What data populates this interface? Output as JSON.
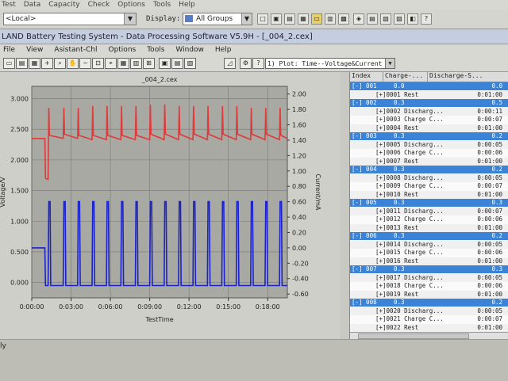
{
  "top_menu": [
    "Test",
    "Data",
    "Capacity",
    "Check",
    "Options",
    "Tools",
    "Help"
  ],
  "toolbar_top": {
    "location": "<Local>",
    "display_label": "Display:",
    "display_value": "All Groups"
  },
  "window": {
    "title": "LAND Battery Testing System - Data Processing Software V5.9H - [_004_2.cex]"
  },
  "menu": [
    "File",
    "View",
    "Asistant-Chl",
    "Options",
    "Tools",
    "Window",
    "Help"
  ],
  "plot_select": "1) Plot: Time--Voltage&Current",
  "status_text": "ly",
  "colors": {
    "voltage": "#e03a3a",
    "current": "#1a22c8",
    "plot_bg": "#a9a9a3",
    "group_row": "#3b83d6"
  },
  "chart_data": {
    "type": "line",
    "title": "_004_2.cex",
    "xlabel": "TestTime",
    "ylabel_left": "Voltage/V",
    "ylabel_right": "Current/mA",
    "x_ticks": [
      "0:00:00",
      "0:03:00",
      "0:06:00",
      "0:09:00",
      "0:12:00",
      "0:15:00",
      "0:18:00"
    ],
    "x_tick_minutes": [
      0,
      3,
      6,
      9,
      12,
      15,
      18
    ],
    "xlim_minutes": [
      0,
      19.5
    ],
    "y_left_ticks": [
      "3.000",
      "2.500",
      "2.000",
      "1.500",
      "1.000",
      "0.500",
      "0.000"
    ],
    "y_left_tick_values": [
      3.0,
      2.5,
      2.0,
      1.5,
      1.0,
      0.5,
      0.0
    ],
    "ylim_left": [
      -0.25,
      3.2
    ],
    "y_right_ticks": [
      "2.00",
      "1.80",
      "1.60",
      "1.40",
      "1.20",
      "1.00",
      "0.80",
      "0.60",
      "0.40",
      "0.20",
      "0.00",
      "-0.20",
      "-0.40",
      "-0.60"
    ],
    "y_right_tick_values": [
      2.0,
      1.8,
      1.6,
      1.4,
      1.2,
      1.0,
      0.8,
      0.6,
      0.4,
      0.2,
      0.0,
      -0.2,
      -0.4,
      -0.6
    ],
    "ylim_right": [
      -0.65,
      2.1
    ],
    "grid": true,
    "series": [
      {
        "name": "Voltage",
        "axis": "left",
        "color": "#e03a3a",
        "points": [
          [
            0,
            2.35
          ],
          [
            1.0,
            2.35
          ],
          [
            1.05,
            1.7
          ],
          [
            1.25,
            1.68
          ],
          [
            1.3,
            2.85
          ],
          [
            1.35,
            2.4
          ],
          [
            2.4,
            2.35
          ],
          [
            2.45,
            2.85
          ],
          [
            2.5,
            2.42
          ],
          [
            3.5,
            2.35
          ],
          [
            3.55,
            2.85
          ],
          [
            3.6,
            2.4
          ],
          [
            4.6,
            2.33
          ],
          [
            4.65,
            2.88
          ],
          [
            4.7,
            2.4
          ],
          [
            5.7,
            2.33
          ],
          [
            5.75,
            2.88
          ],
          [
            5.8,
            2.4
          ],
          [
            6.8,
            2.33
          ],
          [
            6.85,
            2.88
          ],
          [
            6.9,
            2.4
          ],
          [
            7.9,
            2.33
          ],
          [
            7.95,
            2.88
          ],
          [
            8.0,
            2.4
          ],
          [
            9.0,
            2.33
          ],
          [
            9.05,
            2.9
          ],
          [
            9.1,
            2.42
          ],
          [
            10.1,
            2.33
          ],
          [
            10.15,
            2.9
          ],
          [
            10.2,
            2.42
          ],
          [
            11.2,
            2.33
          ],
          [
            11.25,
            2.88
          ],
          [
            11.3,
            2.42
          ],
          [
            12.3,
            2.33
          ],
          [
            12.35,
            2.88
          ],
          [
            12.4,
            2.42
          ],
          [
            13.4,
            2.33
          ],
          [
            13.45,
            2.88
          ],
          [
            13.5,
            2.42
          ],
          [
            14.5,
            2.33
          ],
          [
            14.55,
            2.88
          ],
          [
            14.6,
            2.42
          ],
          [
            15.6,
            2.33
          ],
          [
            15.65,
            2.88
          ],
          [
            15.7,
            2.42
          ],
          [
            16.7,
            2.33
          ],
          [
            16.75,
            2.85
          ],
          [
            16.8,
            2.42
          ],
          [
            17.8,
            2.33
          ],
          [
            17.85,
            2.85
          ],
          [
            17.9,
            2.42
          ],
          [
            18.9,
            2.33
          ],
          [
            18.95,
            2.85
          ],
          [
            19.0,
            2.4
          ],
          [
            19.5,
            2.35
          ]
        ]
      },
      {
        "name": "Current",
        "axis": "right",
        "color": "#1a22c8",
        "points": [
          [
            0,
            0.0
          ],
          [
            1.0,
            0.0
          ],
          [
            1.05,
            -0.49
          ],
          [
            1.25,
            -0.49
          ],
          [
            1.3,
            0.6
          ],
          [
            1.4,
            0.6
          ],
          [
            1.45,
            -0.49
          ],
          [
            2.4,
            -0.49
          ],
          [
            2.45,
            0.6
          ],
          [
            2.55,
            0.6
          ],
          [
            2.6,
            -0.49
          ],
          [
            3.5,
            -0.49
          ],
          [
            3.55,
            0.6
          ],
          [
            3.65,
            0.6
          ],
          [
            3.7,
            -0.49
          ],
          [
            4.6,
            -0.49
          ],
          [
            4.65,
            0.6
          ],
          [
            4.75,
            0.6
          ],
          [
            4.8,
            -0.49
          ],
          [
            5.7,
            -0.49
          ],
          [
            5.75,
            0.6
          ],
          [
            5.85,
            0.6
          ],
          [
            5.9,
            -0.49
          ],
          [
            6.8,
            -0.49
          ],
          [
            6.85,
            0.6
          ],
          [
            6.95,
            0.6
          ],
          [
            7.0,
            -0.49
          ],
          [
            7.9,
            -0.49
          ],
          [
            7.95,
            0.6
          ],
          [
            8.05,
            0.6
          ],
          [
            8.1,
            -0.49
          ],
          [
            9.0,
            -0.49
          ],
          [
            9.05,
            0.6
          ],
          [
            9.15,
            0.6
          ],
          [
            9.2,
            -0.49
          ],
          [
            10.1,
            -0.49
          ],
          [
            10.15,
            0.6
          ],
          [
            10.25,
            0.6
          ],
          [
            10.3,
            -0.49
          ],
          [
            11.2,
            -0.49
          ],
          [
            11.25,
            0.6
          ],
          [
            11.35,
            0.6
          ],
          [
            11.4,
            -0.49
          ],
          [
            12.3,
            -0.49
          ],
          [
            12.35,
            0.6
          ],
          [
            12.45,
            0.6
          ],
          [
            12.5,
            -0.49
          ],
          [
            13.4,
            -0.49
          ],
          [
            13.45,
            0.6
          ],
          [
            13.55,
            0.6
          ],
          [
            13.6,
            -0.49
          ],
          [
            14.5,
            -0.49
          ],
          [
            14.55,
            0.6
          ],
          [
            14.65,
            0.6
          ],
          [
            14.7,
            -0.49
          ],
          [
            15.6,
            -0.49
          ],
          [
            15.65,
            0.6
          ],
          [
            15.75,
            0.6
          ],
          [
            15.8,
            -0.49
          ],
          [
            16.7,
            -0.49
          ],
          [
            16.75,
            0.6
          ],
          [
            16.85,
            0.6
          ],
          [
            16.9,
            -0.49
          ],
          [
            17.8,
            -0.49
          ],
          [
            17.85,
            0.6
          ],
          [
            17.95,
            0.6
          ],
          [
            18.0,
            -0.49
          ],
          [
            18.9,
            -0.49
          ],
          [
            18.95,
            0.6
          ],
          [
            19.05,
            0.6
          ],
          [
            19.1,
            -0.49
          ],
          [
            19.5,
            -0.49
          ]
        ]
      }
    ]
  },
  "table": {
    "headers": [
      "Index",
      "Charge-...",
      "Discharge-S..."
    ],
    "rows": [
      {
        "kind": "group",
        "index": "[-] 001",
        "c2": "0.0",
        "c3": "0.0"
      },
      {
        "kind": "child",
        "label": "[+]0001 Rest",
        "c3": "0:01:00"
      },
      {
        "kind": "group",
        "index": "[-] 002",
        "c2": "0.3",
        "c3": "0.5"
      },
      {
        "kind": "child",
        "label": "[+]0002 Discharg...",
        "c3": "0:00:11"
      },
      {
        "kind": "child",
        "label": "[+]0003 Charge C...",
        "c3": "0:00:07"
      },
      {
        "kind": "child",
        "label": "[+]0004 Rest",
        "c3": "0:01:00"
      },
      {
        "kind": "group",
        "index": "[-] 003",
        "c2": "0.3",
        "c3": "0.2"
      },
      {
        "kind": "child",
        "label": "[+]0005 Discharg...",
        "c3": "0:00:05"
      },
      {
        "kind": "child",
        "label": "[+]0006 Charge C...",
        "c3": "0:00:06"
      },
      {
        "kind": "child",
        "label": "[+]0007 Rest",
        "c3": "0:01:00"
      },
      {
        "kind": "group",
        "index": "[-] 004",
        "c2": "0.3",
        "c3": "0.2"
      },
      {
        "kind": "child",
        "label": "[+]0008 Discharg...",
        "c3": "0:00:05"
      },
      {
        "kind": "child",
        "label": "[+]0009 Charge C...",
        "c3": "0:00:07"
      },
      {
        "kind": "child",
        "label": "[+]0010 Rest",
        "c3": "0:01:00"
      },
      {
        "kind": "group",
        "index": "[-] 005",
        "c2": "0.3",
        "c3": "0.3"
      },
      {
        "kind": "child",
        "label": "[+]0011 Discharg...",
        "c3": "0:00:07"
      },
      {
        "kind": "child",
        "label": "[+]0012 Charge C...",
        "c3": "0:00:06"
      },
      {
        "kind": "child",
        "label": "[+]0013 Rest",
        "c3": "0:01:00"
      },
      {
        "kind": "group",
        "index": "[-] 006",
        "c2": "0.3",
        "c3": "0.2"
      },
      {
        "kind": "child",
        "label": "[+]0014 Discharg...",
        "c3": "0:00:05"
      },
      {
        "kind": "child",
        "label": "[+]0015 Charge C...",
        "c3": "0:00:06"
      },
      {
        "kind": "child",
        "label": "[+]0016 Rest",
        "c3": "0:01:00"
      },
      {
        "kind": "group",
        "index": "[-] 007",
        "c2": "0.3",
        "c3": "0.3"
      },
      {
        "kind": "child",
        "label": "[+]0017 Discharg...",
        "c3": "0:00:05"
      },
      {
        "kind": "child",
        "label": "[+]0018 Charge C...",
        "c3": "0:00:06"
      },
      {
        "kind": "child",
        "label": "[+]0019 Rest",
        "c3": "0:01:00"
      },
      {
        "kind": "group",
        "index": "[-] 008",
        "c2": "0.3",
        "c3": "0.2"
      },
      {
        "kind": "child",
        "label": "[+]0020 Discharg...",
        "c3": "0:00:05"
      },
      {
        "kind": "child",
        "label": "[+]0021 Charge C...",
        "c3": "0:00:07"
      },
      {
        "kind": "child",
        "label": "[+]0022 Rest",
        "c3": "0:01:00"
      }
    ]
  }
}
